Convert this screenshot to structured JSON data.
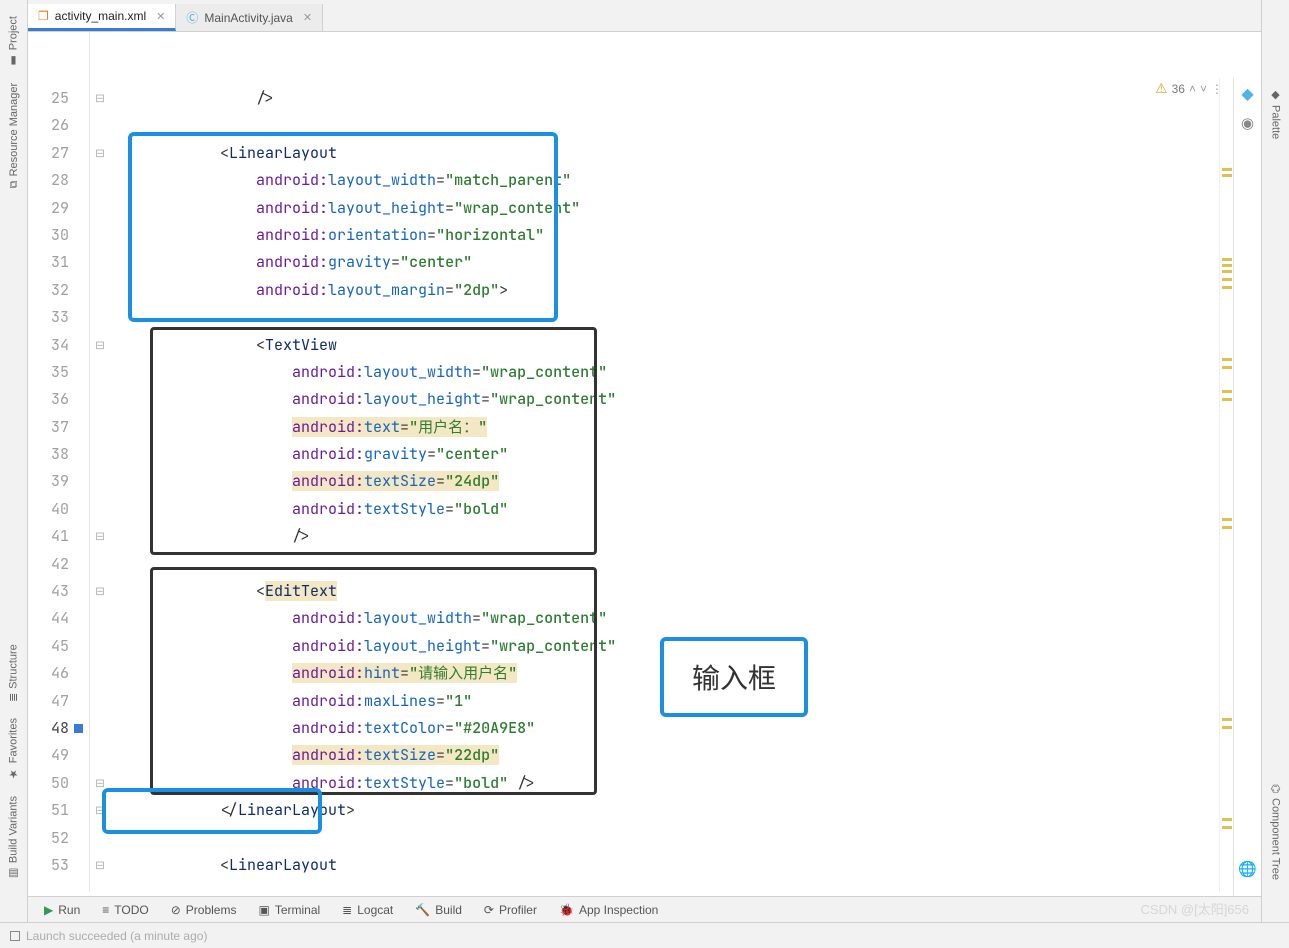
{
  "tabs": [
    {
      "label": "activity_main.xml",
      "active": true,
      "icon": "xml"
    },
    {
      "label": "MainActivity.java",
      "active": false,
      "icon": "class"
    }
  ],
  "left_tool_windows": [
    "Project",
    "Resource Manager",
    "Structure",
    "Favorites",
    "Build Variants"
  ],
  "right_tool_windows": [
    "Palette",
    "Component Tree"
  ],
  "inspection": {
    "warnings": "36"
  },
  "callout": "输入框",
  "watermark": "CSDN @[太阳]656",
  "bottom_tools": [
    "Run",
    "TODO",
    "Problems",
    "Terminal",
    "Logcat",
    "Build",
    "Profiler",
    "App Inspection"
  ],
  "status_text": "Launch succeeded (a minute ago)",
  "line_start": 25,
  "current_line": 48,
  "code": {
    "l25": "            />",
    "l26": "",
    "l27_tag": "LinearLayout",
    "l28": {
      "ns": "android:",
      "attr": "layout_width",
      "val": "\"match_parent\""
    },
    "l29": {
      "ns": "android:",
      "attr": "layout_height",
      "val": "\"wrap_content\""
    },
    "l30": {
      "ns": "android:",
      "attr": "orientation",
      "val": "\"horizontal\""
    },
    "l31": {
      "ns": "android:",
      "attr": "gravity",
      "val": "\"center\""
    },
    "l32": {
      "ns": "android:",
      "attr": "layout_margin",
      "val": "\"2dp\"",
      "tail": ">"
    },
    "l34_tag": "TextView",
    "l35": {
      "ns": "android:",
      "attr": "layout_width",
      "val": "\"wrap_content\""
    },
    "l36": {
      "ns": "android:",
      "attr": "layout_height",
      "val": "\"wrap_content\""
    },
    "l37": {
      "ns": "android:",
      "attr": "text",
      "val": "\"用户名：\""
    },
    "l38": {
      "ns": "android:",
      "attr": "gravity",
      "val": "\"center\""
    },
    "l39": {
      "ns": "android:",
      "attr": "textSize",
      "val": "\"24dp\""
    },
    "l40": {
      "ns": "android:",
      "attr": "textStyle",
      "val": "\"bold\""
    },
    "l41": "                />",
    "l43_tag": "EditText",
    "l44": {
      "ns": "android:",
      "attr": "layout_width",
      "val": "\"wrap_content\""
    },
    "l45": {
      "ns": "android:",
      "attr": "layout_height",
      "val": "\"wrap_content\""
    },
    "l46": {
      "ns": "android:",
      "attr": "hint",
      "val": "\"请输入用户名\""
    },
    "l47": {
      "ns": "android:",
      "attr": "maxLines",
      "val": "\"1\""
    },
    "l48": {
      "ns": "android:",
      "attr": "textColor",
      "val": "\"#20A9E8\""
    },
    "l49": {
      "ns": "android:",
      "attr": "textSize",
      "val": "\"22dp\""
    },
    "l50": {
      "ns": "android:",
      "attr": "textStyle",
      "val": "\"bold\"",
      "tail": " />"
    },
    "l51_close": "LinearLayout",
    "l53_tag": "LinearLayout"
  }
}
